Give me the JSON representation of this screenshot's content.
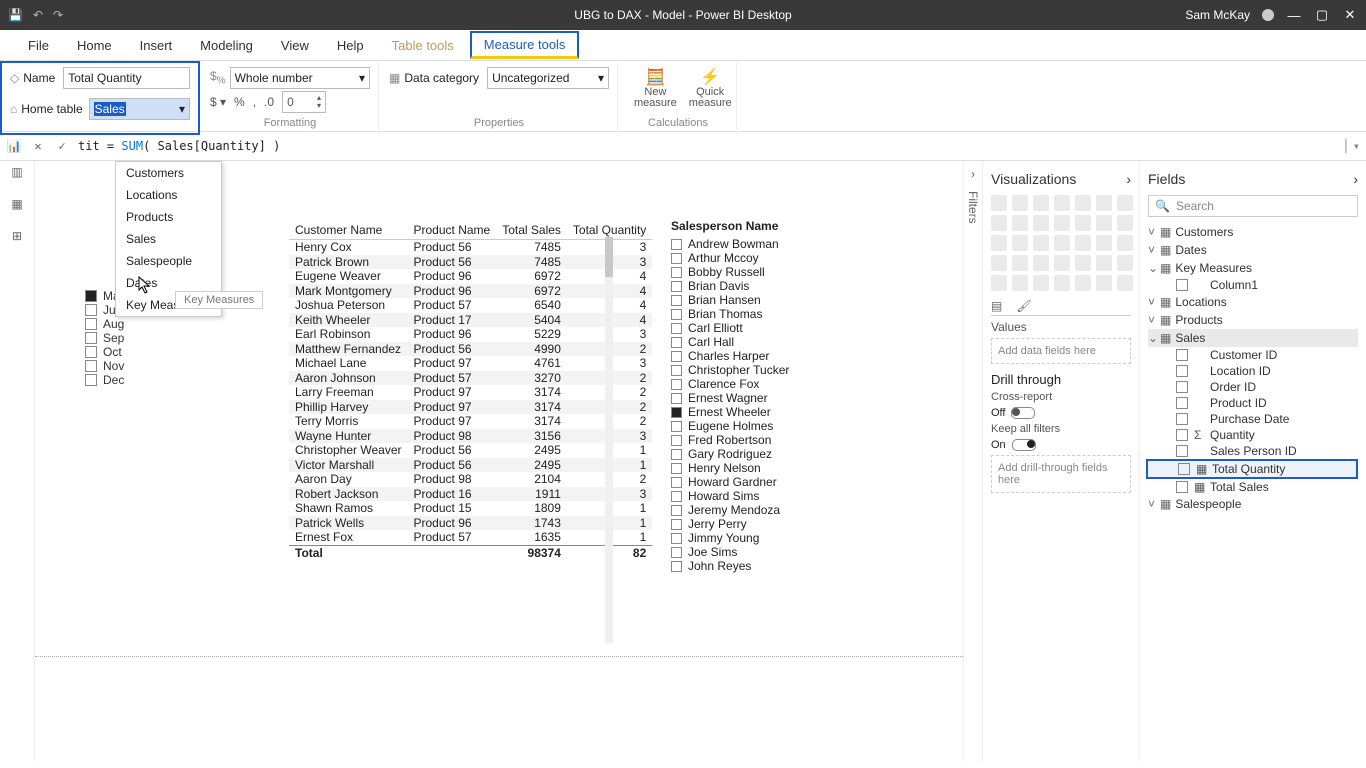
{
  "titlebar": {
    "title": "UBG to DAX - Model - Power BI Desktop",
    "user": "Sam McKay"
  },
  "ribbon_tabs": [
    "File",
    "Home",
    "Insert",
    "Modeling",
    "View",
    "Help",
    "Table tools",
    "Measure tools"
  ],
  "structure": {
    "name_label": "Name",
    "name_value": "Total Quantity",
    "hometable_label": "Home table",
    "hometable_value": "Sales",
    "hometable_options": [
      "Customers",
      "Locations",
      "Products",
      "Sales",
      "Salespeople",
      "Dates",
      "Key Measures"
    ],
    "tooltip": "Key Measures"
  },
  "formatting": {
    "format_value": "Whole number",
    "decimals": "0",
    "group_label": "Formatting"
  },
  "properties": {
    "datacat_label": "Data category",
    "datacat_value": "Uncategorized",
    "group_label": "Properties"
  },
  "calculations": {
    "new_measure": "New measure",
    "quick_measure": "Quick measure",
    "group_label": "Calculations"
  },
  "formula": {
    "lhs": "tit",
    "fn": "SUM",
    "arg": "Sales[Quantity]"
  },
  "slicer_months": [
    {
      "label": "May",
      "checked": true
    },
    {
      "label": "Jul",
      "checked": false
    },
    {
      "label": "Aug",
      "checked": false
    },
    {
      "label": "Sep",
      "checked": false
    },
    {
      "label": "Oct",
      "checked": false
    },
    {
      "label": "Nov",
      "checked": false
    },
    {
      "label": "Dec",
      "checked": false
    }
  ],
  "table": {
    "headers": [
      "Customer Name",
      "Product Name",
      "Total Sales",
      "Total Quantity"
    ],
    "rows": [
      [
        "Henry Cox",
        "Product 56",
        "7485",
        "3"
      ],
      [
        "Patrick Brown",
        "Product 56",
        "7485",
        "3"
      ],
      [
        "Eugene Weaver",
        "Product 96",
        "6972",
        "4"
      ],
      [
        "Mark Montgomery",
        "Product 96",
        "6972",
        "4"
      ],
      [
        "Joshua Peterson",
        "Product 57",
        "6540",
        "4"
      ],
      [
        "Keith Wheeler",
        "Product 17",
        "5404",
        "4"
      ],
      [
        "Earl Robinson",
        "Product 96",
        "5229",
        "3"
      ],
      [
        "Matthew Fernandez",
        "Product 56",
        "4990",
        "2"
      ],
      [
        "Michael Lane",
        "Product 97",
        "4761",
        "3"
      ],
      [
        "Aaron Johnson",
        "Product 57",
        "3270",
        "2"
      ],
      [
        "Larry Freeman",
        "Product 97",
        "3174",
        "2"
      ],
      [
        "Phillip Harvey",
        "Product 97",
        "3174",
        "2"
      ],
      [
        "Terry Morris",
        "Product 97",
        "3174",
        "2"
      ],
      [
        "Wayne Hunter",
        "Product 98",
        "3156",
        "3"
      ],
      [
        "Christopher Weaver",
        "Product 56",
        "2495",
        "1"
      ],
      [
        "Victor Marshall",
        "Product 56",
        "2495",
        "1"
      ],
      [
        "Aaron Day",
        "Product 98",
        "2104",
        "2"
      ],
      [
        "Robert Jackson",
        "Product 16",
        "1911",
        "3"
      ],
      [
        "Shawn Ramos",
        "Product 15",
        "1809",
        "1"
      ],
      [
        "Patrick Wells",
        "Product 96",
        "1743",
        "1"
      ],
      [
        "Ernest Fox",
        "Product 57",
        "1635",
        "1"
      ]
    ],
    "total_label": "Total",
    "total_sales": "98374",
    "total_qty": "82"
  },
  "salespeople": {
    "header": "Salesperson Name",
    "items": [
      {
        "name": "Andrew Bowman",
        "checked": false
      },
      {
        "name": "Arthur Mccoy",
        "checked": false
      },
      {
        "name": "Bobby Russell",
        "checked": false
      },
      {
        "name": "Brian Davis",
        "checked": false
      },
      {
        "name": "Brian Hansen",
        "checked": false
      },
      {
        "name": "Brian Thomas",
        "checked": false
      },
      {
        "name": "Carl Elliott",
        "checked": false
      },
      {
        "name": "Carl Hall",
        "checked": false
      },
      {
        "name": "Charles Harper",
        "checked": false
      },
      {
        "name": "Christopher Tucker",
        "checked": false
      },
      {
        "name": "Clarence Fox",
        "checked": false
      },
      {
        "name": "Ernest Wagner",
        "checked": false
      },
      {
        "name": "Ernest Wheeler",
        "checked": true
      },
      {
        "name": "Eugene Holmes",
        "checked": false
      },
      {
        "name": "Fred Robertson",
        "checked": false
      },
      {
        "name": "Gary Rodriguez",
        "checked": false
      },
      {
        "name": "Henry Nelson",
        "checked": false
      },
      {
        "name": "Howard Gardner",
        "checked": false
      },
      {
        "name": "Howard Sims",
        "checked": false
      },
      {
        "name": "Jeremy Mendoza",
        "checked": false
      },
      {
        "name": "Jerry Perry",
        "checked": false
      },
      {
        "name": "Jimmy Young",
        "checked": false
      },
      {
        "name": "Joe Sims",
        "checked": false
      },
      {
        "name": "John Reyes",
        "checked": false
      }
    ]
  },
  "viz_pane": {
    "title": "Visualizations",
    "values_label": "Values",
    "values_placeholder": "Add data fields here",
    "drill_title": "Drill through",
    "cross_report": "Cross-report",
    "off": "Off",
    "keep_filters": "Keep all filters",
    "on": "On",
    "drill_placeholder": "Add drill-through fields here"
  },
  "fields_pane": {
    "title": "Fields",
    "search_placeholder": "Search",
    "tables": [
      {
        "name": "Customers",
        "expanded": false
      },
      {
        "name": "Dates",
        "expanded": false
      },
      {
        "name": "Key Measures",
        "expanded": true,
        "fields": [
          {
            "name": "Column1",
            "icon": ""
          }
        ]
      },
      {
        "name": "Locations",
        "expanded": false
      },
      {
        "name": "Products",
        "expanded": false
      },
      {
        "name": "Sales",
        "expanded": true,
        "selected": true,
        "fields": [
          {
            "name": "Customer ID"
          },
          {
            "name": "Location ID"
          },
          {
            "name": "Order ID"
          },
          {
            "name": "Product ID"
          },
          {
            "name": "Purchase Date"
          },
          {
            "name": "Quantity",
            "icon": "Σ"
          },
          {
            "name": "Sales Person ID"
          },
          {
            "name": "Total Quantity",
            "icon": "▦",
            "highlighted": true
          },
          {
            "name": "Total Sales",
            "icon": "▦"
          }
        ]
      },
      {
        "name": "Salespeople",
        "expanded": false
      }
    ]
  },
  "filters_label": "Filters"
}
